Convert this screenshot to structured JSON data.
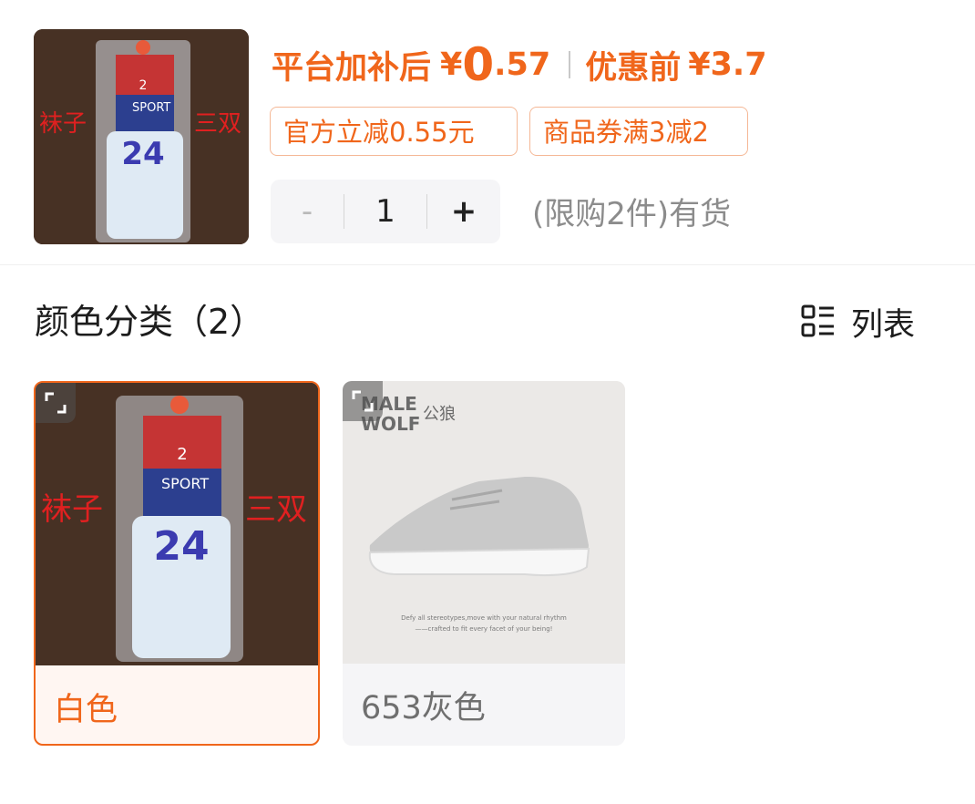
{
  "product": {
    "thumb_text_left": "袜子",
    "thumb_text_right": "三双",
    "thumb_package_text": "SPORT",
    "thumb_number": "24",
    "thumb_tag_number": "2"
  },
  "price": {
    "platform_label": "平台加补后",
    "currency": "¥",
    "integer": "0",
    "decimal": ".57",
    "original_label": "优惠前",
    "original_value": "¥3.7"
  },
  "tags": [
    "官方立减0.55元",
    "商品券满3减2"
  ],
  "quantity": {
    "minus": "-",
    "value": "1",
    "plus": "+",
    "stock_text": "(限购2件)有货"
  },
  "section": {
    "title": "颜色分类（2）",
    "view_label": "列表"
  },
  "options": [
    {
      "label": "白色",
      "selected": true,
      "img_text_left": "袜子",
      "img_text_right": "三双",
      "img_package_text": "SPORT",
      "img_number": "24",
      "img_tag_number": "2"
    },
    {
      "label": "653灰色",
      "selected": false,
      "brand_en": "MALE WOLF",
      "brand_line1": "MALE",
      "brand_line2": "WOLF",
      "brand_cn": "公狼",
      "tagline_1": "Defy all stereotypes,move with your natural rhythm",
      "tagline_2": "——crafted to fit every facet of your being!"
    }
  ],
  "colors": {
    "accent": "#f0661b",
    "tag_border": "#f5b896",
    "muted": "#8c8c8c"
  }
}
